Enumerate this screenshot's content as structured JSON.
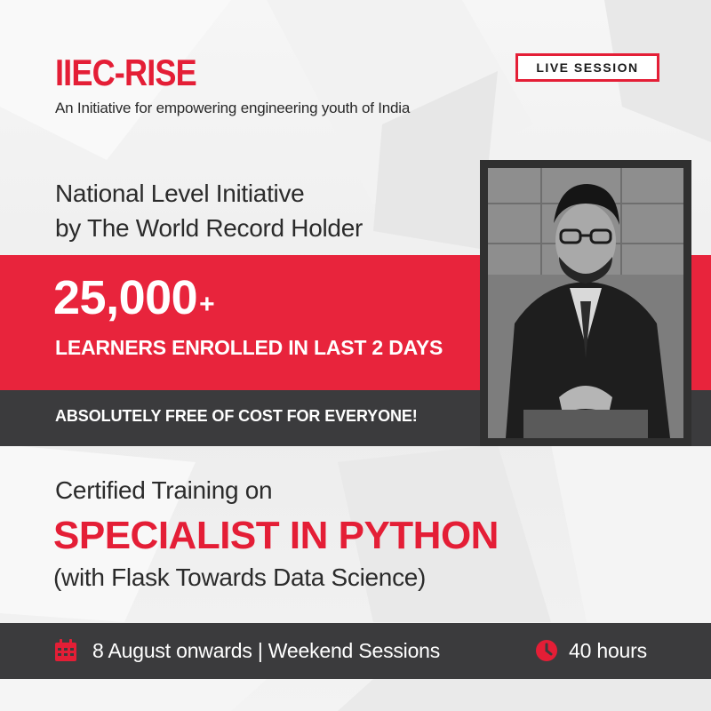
{
  "brand": {
    "name": "IIEC-RISE",
    "tagline": "An Initiative for empowering engineering youth of India"
  },
  "badge": {
    "label": "LIVE SESSION"
  },
  "initiative": {
    "line1": "National Level Initiative",
    "line2": "by The World Record Holder"
  },
  "stats": {
    "count": "25,000",
    "count_suffix": "+",
    "caption": "LEARNERS ENROLLED IN LAST 2 DAYS"
  },
  "offer": {
    "text": "ABSOLUTELY FREE OF COST FOR EVERYONE!"
  },
  "course": {
    "intro": "Certified Training on",
    "title": "SPECIALIST IN PYTHON",
    "subtitle": "(with Flask Towards Data Science)"
  },
  "details": {
    "schedule": "8 August onwards | Weekend Sessions",
    "duration": "40 hours",
    "calendar_icon": "calendar-icon",
    "clock_icon": "clock-icon"
  },
  "colors": {
    "accent": "#e41e36",
    "band_red": "#e8243c",
    "band_dark": "#3b3b3d",
    "background": "#efefef"
  }
}
